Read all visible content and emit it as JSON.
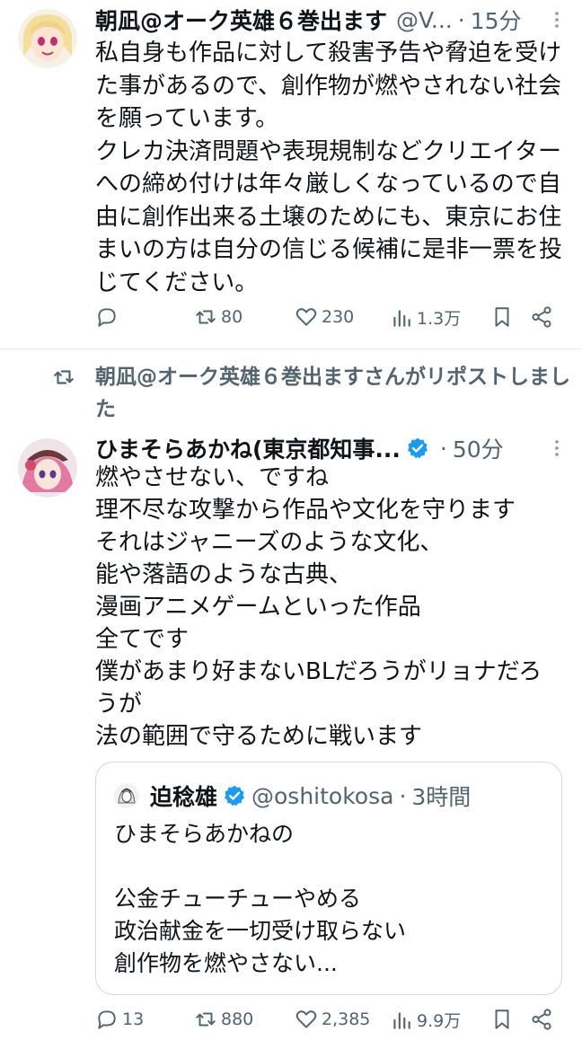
{
  "tweet1": {
    "author_name": "朝凪@オーク英雄６巻出ます",
    "handle": "@V...",
    "dot": "·",
    "time": "15分",
    "text": "私自身も作品に対して殺害予告や脅迫を受けた事があるので、創作物が燃やされない社会を願っています。\nクレカ決済問題や表現規制などクリエイターへの締め付けは年々厳しくなっているので自由に創作出来る土壌のためにも、東京にお住まいの方は自分の信じる候補に是非一票を投じてください。",
    "actions": {
      "replies": "",
      "retweets": "80",
      "likes": "230",
      "views": "1.3万"
    }
  },
  "tweet2": {
    "repost_banner": "朝凪@オーク英雄６巻出ますさんがリポストしました",
    "author_name": "ひまそらあかね(東京都知事...",
    "dot": "·",
    "time": "50分",
    "text": "燃やさせない、ですね\n理不尽な攻撃から作品や文化を守ります\nそれはジャニーズのような文化、\n能や落語のような古典、\n漫画アニメゲームといった作品\n全てです\n僕があまり好まないBLだろうがリョナだろうが\n法の範囲で守るために戦います",
    "quote": {
      "author_name": "迫稔雄",
      "handle": "@oshitokosa",
      "dot": "·",
      "time": "3時間",
      "text": "ひまそらあかねの\n\n公金チューチューやめる\n政治献金を一切受け取らない\n創作物を燃やさない..."
    },
    "actions": {
      "replies": "13",
      "retweets": "880",
      "likes": "2,385",
      "views": "9.9万"
    }
  },
  "colors": {
    "text_primary": "#0f1419",
    "text_secondary": "#536471",
    "verified_blue": "#1d9bf0",
    "border": "#cfd9de"
  }
}
